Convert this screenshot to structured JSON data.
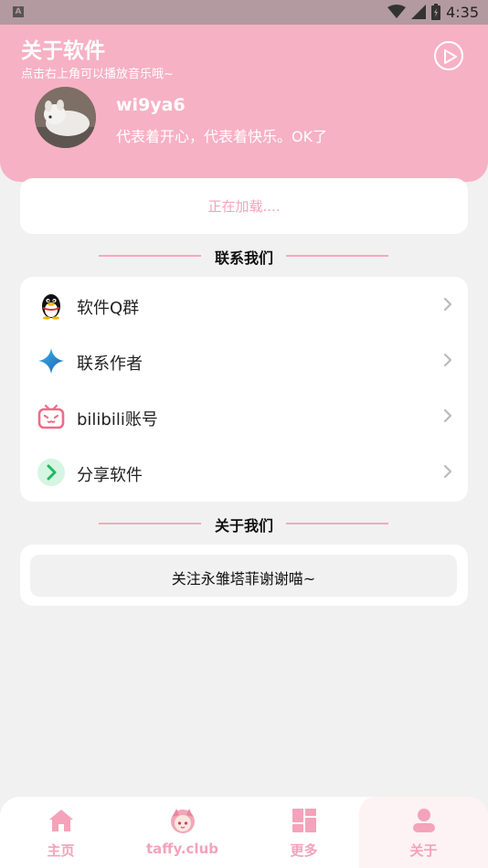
{
  "status_bar": {
    "time": "4:35",
    "left_icon": "A"
  },
  "header": {
    "title": "关于软件",
    "subtitle": "点击右上角可以播放音乐哦~",
    "username": "wi9ya6",
    "bio": "代表着开心，代表着快乐。OK了"
  },
  "loading": {
    "text": "正在加载...."
  },
  "contact_section": {
    "title": "联系我们",
    "items": [
      {
        "label": "软件Q群",
        "icon": "qq-penguin-icon"
      },
      {
        "label": "联系作者",
        "icon": "sparkle-star-icon"
      },
      {
        "label": "bilibili账号",
        "icon": "bilibili-tv-icon"
      },
      {
        "label": "分享软件",
        "icon": "share-arrow-icon"
      }
    ]
  },
  "about_section": {
    "title": "关于我们",
    "text": "关注永雏塔菲谢谢喵~"
  },
  "tabbar": {
    "tabs": [
      {
        "label": "主页",
        "icon": "home-icon"
      },
      {
        "label": "taffy.club",
        "icon": "taffy-avatar-icon"
      },
      {
        "label": "更多",
        "icon": "dashboard-icon"
      },
      {
        "label": "关于",
        "icon": "user-icon"
      }
    ],
    "active": "关于"
  },
  "colors": {
    "accent": "#f7b1c4",
    "accent_text": "#f4a3ba",
    "background": "#f1f1f1"
  }
}
